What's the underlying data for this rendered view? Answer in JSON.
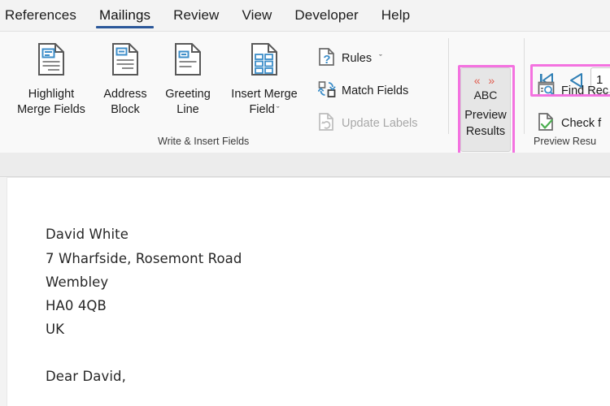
{
  "window": {
    "app": "word-mail-merge"
  },
  "tabs": [
    {
      "label": "References",
      "active": false
    },
    {
      "label": "Mailings",
      "active": true
    },
    {
      "label": "Review",
      "active": false
    },
    {
      "label": "View",
      "active": false
    },
    {
      "label": "Developer",
      "active": false
    },
    {
      "label": "Help",
      "active": false
    }
  ],
  "ribbon": {
    "groups": [
      {
        "label": "Write & Insert Fields"
      },
      {
        "label": "Preview Resu"
      }
    ],
    "big_buttons": [
      {
        "label_line1": "Highlight",
        "label_line2": "Merge Fields",
        "icon": "highlight-merge-fields-icon",
        "has_dropdown": false
      },
      {
        "label_line1": "Address",
        "label_line2": "Block",
        "icon": "address-block-icon",
        "has_dropdown": false
      },
      {
        "label_line1": "Greeting",
        "label_line2": "Line",
        "icon": "greeting-line-icon",
        "has_dropdown": false
      },
      {
        "label_line1": "Insert Merge",
        "label_line2": "Field",
        "icon": "insert-merge-field-icon",
        "has_dropdown": true,
        "dropdown_glyph": "ˇ"
      }
    ],
    "small_buttons": [
      {
        "label": "Rules",
        "icon": "rules-icon",
        "disabled": false,
        "has_dropdown": true,
        "dropdown_glyph": "ˇ"
      },
      {
        "label": "Match Fields",
        "icon": "match-fields-icon",
        "disabled": false,
        "has_dropdown": false
      },
      {
        "label": "Update Labels",
        "icon": "update-labels-icon",
        "disabled": true,
        "has_dropdown": false
      }
    ],
    "preview_results": {
      "label_line1": "Preview",
      "label_line2": "Results",
      "icon_arrows": "« »",
      "icon_text": "ABC",
      "pressed": true,
      "highlighted": true
    },
    "navigation": {
      "first_record_glyph": "first-record-icon",
      "previous_record_glyph": "previous-record-icon",
      "record_number": "1",
      "highlighted": true
    },
    "preview_small_buttons": [
      {
        "label": "Find Rec",
        "icon": "find-recipient-icon"
      },
      {
        "label": "Check f",
        "icon": "check-for-errors-icon"
      }
    ]
  },
  "document": {
    "lines": [
      "David White",
      "7 Wharfside, Rosemont Road",
      "Wembley",
      "HA0 4QB",
      "UK",
      "Dear David,"
    ]
  },
  "colors": {
    "tab_accent": "#2b579a",
    "highlight": "#f472e0",
    "icon_blue": "#3d8ec9",
    "abc_red": "#e05c4e",
    "ribbon_bg": "#f9f9f9"
  }
}
